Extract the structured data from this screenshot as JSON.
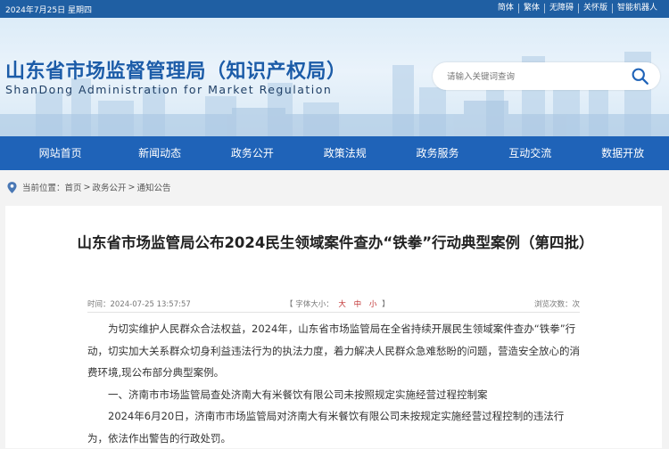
{
  "topbar": {
    "date": "2024年7月25日 星期四",
    "links": [
      "简体",
      "繁体",
      "无障碍",
      "关怀版",
      "智能机器人"
    ]
  },
  "header": {
    "title": "山东省市场监督管理局（知识产权局）",
    "subtitle": "ShanDong Administration for Market Regulation",
    "search_placeholder": "请输入关键词查询"
  },
  "nav": [
    "网站首页",
    "新闻动态",
    "政务公开",
    "政策法规",
    "政务服务",
    "互动交流",
    "数据开放"
  ],
  "breadcrumb": {
    "label": "当前位置：",
    "items": [
      "首页",
      "政务公开",
      "通知公告"
    ],
    "sep": ">"
  },
  "article": {
    "title": "山东省市场监管局公布2024民生领域案件查办“铁拳”行动典型案例（第四批）",
    "time": "时间：2024-07-25 13:57:57",
    "font_size_label": "【 字体大小：",
    "font_sizes": [
      "大",
      "中",
      "小"
    ],
    "font_size_close": " 】",
    "views": "浏览次数：次",
    "paragraphs": [
      "为切实维护人民群众合法权益，2024年，山东省市场监管局在全省持续开展民生领域案件查办“铁拳”行动，切实加大关系群众切身利益违法行为的执法力度，着力解决人民群众急难愁盼的问题，营造安全放心的消费环境,现公布部分典型案例。",
      "一、济南市市场监管局查处济南大有米餐饮有限公司未按照规定实施经营过程控制案",
      "2024年6月20日，济南市市场监管局对济南大有米餐饮有限公司未按规定实施经营过程控制的违法行为，依法作出警告的行政处罚。"
    ]
  },
  "colors": {
    "brand_blue": "#1f63b8",
    "topbar_blue": "#1f5fa3",
    "title_blue": "#1c5ca8"
  }
}
